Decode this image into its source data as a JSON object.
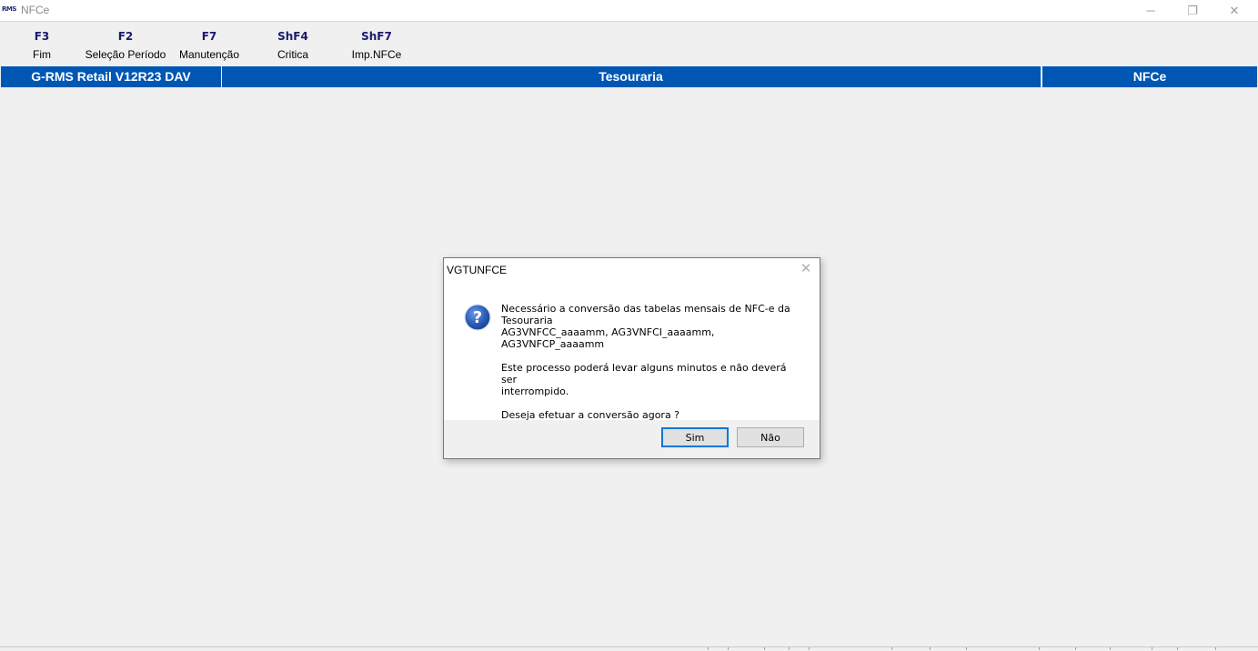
{
  "window": {
    "title": "NFCe",
    "logo_text": "RMS",
    "controls": {
      "minimize": "─",
      "restore": "❐",
      "close": "✕"
    }
  },
  "toolbar": {
    "items": [
      {
        "key": "F3",
        "label": "Fim"
      },
      {
        "key": "F2",
        "label": "Seleção Período"
      },
      {
        "key": "F7",
        "label": "Manutenção"
      },
      {
        "key": "ShF4",
        "label": "Critica"
      },
      {
        "key": "ShF7",
        "label": "Imp.NFCe"
      }
    ]
  },
  "header_band": {
    "left": "G-RMS Retail V12R23 DAV",
    "center": "Tesouraria",
    "right": "NFCe"
  },
  "dialog": {
    "title": "VGTUNFCE",
    "close_glyph": "✕",
    "icon": "question-icon",
    "message": {
      "line1": "Necessário a conversão das tabelas mensais de NFC-e da",
      "line2": "Tesouraria",
      "line3": "AG3VNFCC_aaaamm, AG3VNFCI_aaaamm, AG3VNFCP_aaaamm",
      "line4": "Este processo poderá levar alguns minutos e não deverá ser",
      "line5": "interrompido.",
      "line6": "Deseja efetuar a conversão agora ?"
    },
    "buttons": {
      "yes": "Sim",
      "no": "Não"
    }
  },
  "colors": {
    "band_blue": "#0056b3",
    "fkey_color": "#1a1a6e",
    "background": "#f0f0f0",
    "icon_blue": "#1f4fa8"
  }
}
